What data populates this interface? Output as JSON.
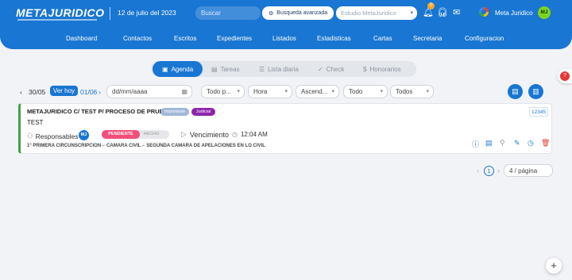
{
  "header": {
    "logo": "METAJURIDICO",
    "date": "12 de julio del 2023",
    "search_placeholder": "Buscar",
    "advanced_search": "Busqueda avanzada",
    "studio_placeholder": "Estudio MetaJuridico",
    "notif_count": "0",
    "user_name": "Meta Juridico",
    "user_initials": "MJ"
  },
  "nav": [
    "Dashboard",
    "Contactos",
    "Escritos",
    "Expedientes",
    "Listados",
    "Estadisticas",
    "Cartas",
    "Secretaria",
    "Configuracion"
  ],
  "tabs": [
    "Agenda",
    "Tareas",
    "Lista diaria",
    "Check",
    "Honorarios"
  ],
  "filters": {
    "prev_date": "30/05",
    "today_btn": "Ver hoy",
    "next_date": "01/06",
    "date_input": "dd/mm/aaaa",
    "type": "Todo p...",
    "sort_field": "Hora",
    "order": "Ascend...",
    "scope": "Todo",
    "who": "Todos"
  },
  "card": {
    "title": "METAJURIDICO C/ TEST P/ PROCESO DE PRUEBA",
    "tag_important": "Importante",
    "tag_judicial": "Judicial",
    "code": "12345",
    "description": "TEST",
    "responsables": "Responsables",
    "resp_initials": "MJ",
    "status_pending": "PENDIENTE",
    "status_done": "HECHO",
    "vencimiento": "Vencimiento",
    "time": "12:04 AM",
    "location": "1° PRIMERA CIRCUNSCRIPCION  ⌐ CAMARA CIVIL  ⌐ SEGUNDA CAMARA DE APELACIONES EN LO CIVIL"
  },
  "pager": {
    "page": "1",
    "page_size": "4 / página"
  },
  "colors": {
    "primary": "#1976d2",
    "pending": "#f0507a",
    "accent_green": "#43a047",
    "judicial": "#8e24aa"
  }
}
